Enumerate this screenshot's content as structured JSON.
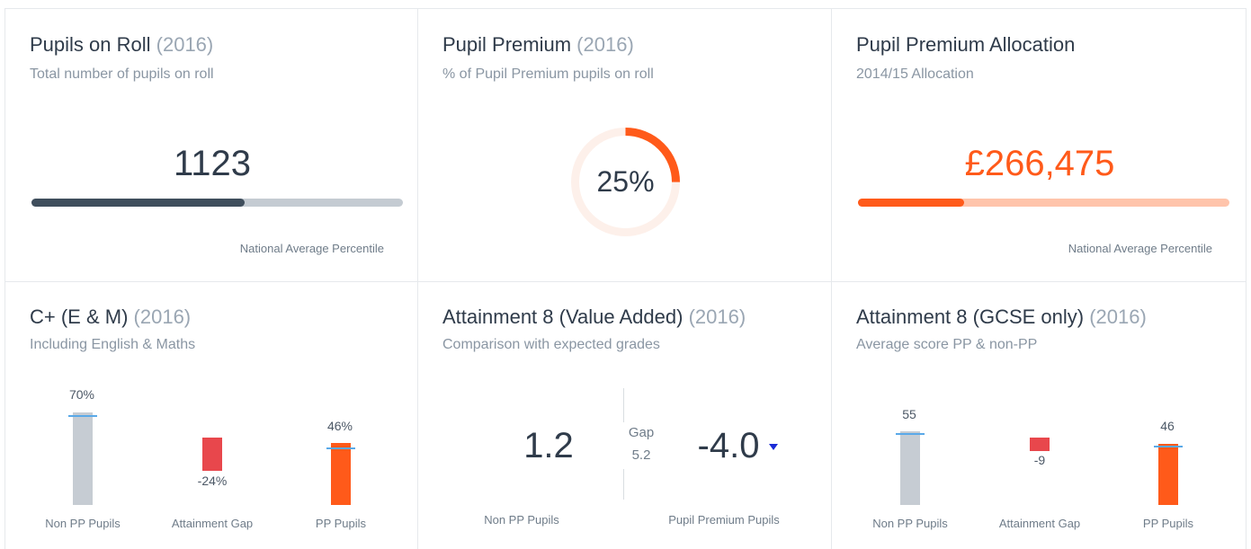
{
  "colors": {
    "dark": "#3f4e5c",
    "grey_track": "#c4cbd2",
    "orange": "#ff5a1a",
    "orange_light": "#ffc4ab",
    "red": "#e8474c",
    "bar_grey": "#c6ccd3",
    "marker_blue": "#5aa9e8",
    "arrow_blue": "#1a2bd6"
  },
  "cards": {
    "roll": {
      "title": "Pupils on Roll",
      "year": "(2016)",
      "subtitle": "Total number of pupils on roll",
      "value": "1123",
      "percentile_fraction": 0.575,
      "note": "National Average Percentile"
    },
    "premium": {
      "title": "Pupil Premium",
      "year": "(2016)",
      "subtitle": "% of Pupil Premium pupils on roll",
      "value": "25%",
      "fraction": 0.25
    },
    "allocation": {
      "title": "Pupil Premium Allocation",
      "subtitle": "2014/15 Allocation",
      "value": "£266,475",
      "percentile_fraction": 0.285,
      "note": "National Average Percentile"
    },
    "cplus": {
      "title": "C+ (E & M)",
      "year": "(2016)",
      "subtitle": "Including English & Maths",
      "non_pp_label": "70%",
      "gap_label": "-24%",
      "pp_label": "46%",
      "non_pp_caption": "Non PP Pupils",
      "gap_caption": "Attainment Gap",
      "pp_caption": "PP Pupils"
    },
    "att8va": {
      "title": "Attainment 8 (Value Added)",
      "year": "(2016)",
      "subtitle": "Comparison with expected grades",
      "non_pp_value": "1.2",
      "gap_label": "Gap",
      "gap_value": "5.2",
      "pp_value": "-4.0",
      "non_pp_caption": "Non PP Pupils",
      "pp_caption": "Pupil Premium Pupils"
    },
    "att8gcse": {
      "title": "Attainment 8 (GCSE only)",
      "year": "(2016)",
      "subtitle": "Average score PP & non-PP",
      "non_pp_label": "55",
      "gap_label": "-9",
      "pp_label": "46",
      "non_pp_caption": "Non PP Pupils",
      "gap_caption": "Attainment Gap",
      "pp_caption": "PP Pupils"
    }
  }
}
